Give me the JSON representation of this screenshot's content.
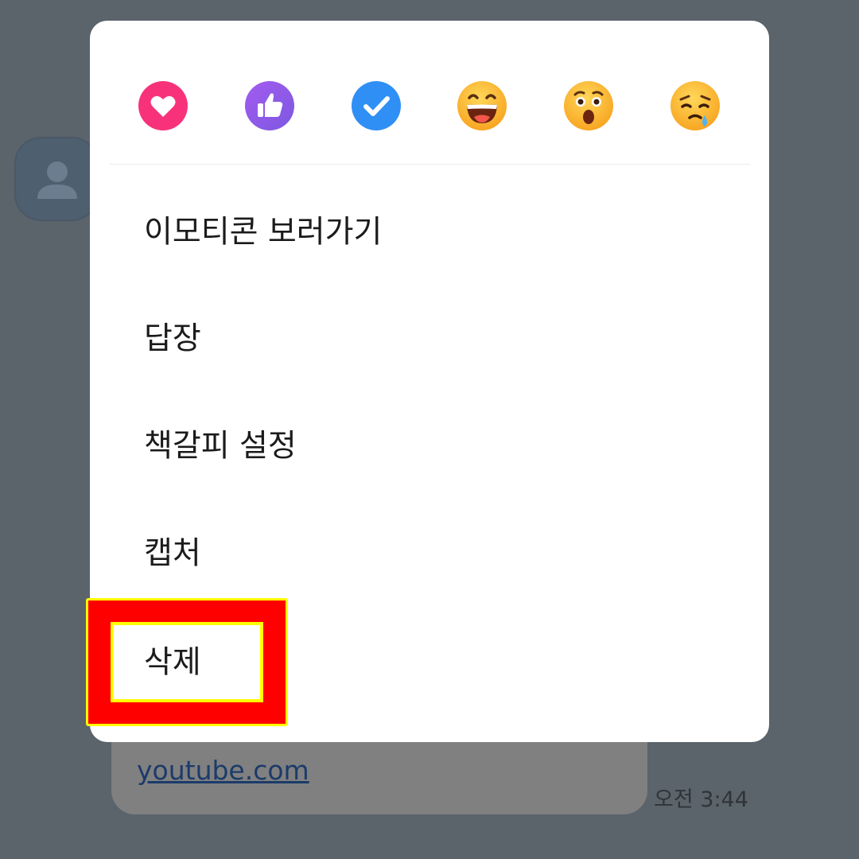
{
  "background_message": {
    "link_text": "youtube.com",
    "time": "오전 3:44"
  },
  "reactions": [
    {
      "name": "heart-icon",
      "color": "#f8327a"
    },
    {
      "name": "thumbs-up-icon",
      "color": "#8f5ee6"
    },
    {
      "name": "check-icon",
      "color": "#2f8ff5"
    },
    {
      "name": "laughing-face-icon",
      "color": "#ffb42b"
    },
    {
      "name": "surprised-face-icon",
      "color": "#ffb42b"
    },
    {
      "name": "sad-face-icon",
      "color": "#ffb42b"
    }
  ],
  "menu": {
    "items": [
      {
        "label": "이모티콘 보러가기"
      },
      {
        "label": "답장"
      },
      {
        "label": "책갈피 설정"
      },
      {
        "label": "캡처"
      },
      {
        "label": "삭제"
      }
    ]
  },
  "highlight": {
    "outer_color": "#ff0000",
    "border_color": "#ffff00"
  }
}
